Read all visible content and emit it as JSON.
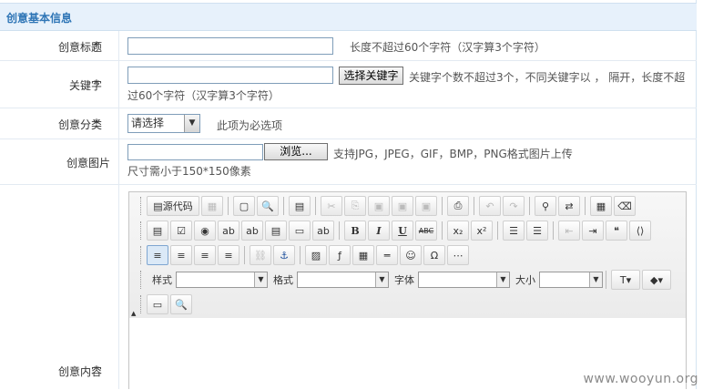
{
  "section_title": "创意基本信息",
  "fields": {
    "title": {
      "label": "创意标题",
      "hint": "长度不超过60个字符（汉字算3个字符）",
      "value": ""
    },
    "keyword": {
      "label": "关键字",
      "button": "选择关键字",
      "hint_line1": "关键字个数不超过3个，不同关键字以 ， 隔开，长度不超",
      "hint_line2": "过60个字符（汉字算3个字符）",
      "value": ""
    },
    "category": {
      "label": "创意分类",
      "selected": "请选择",
      "hint": "此项为必选项"
    },
    "image": {
      "label": "创意图片",
      "browse": "浏览...",
      "hint": "支持JPG，JPEG，GIF，BMP，PNG格式图片上传",
      "size_hint": "尺寸需小于150*150像素"
    },
    "content": {
      "label": "创意内容"
    }
  },
  "editor": {
    "source_label": "源代码",
    "style_label": "样式",
    "format_label": "格式",
    "font_label": "字体",
    "size_label": "大小",
    "bold": "B",
    "italic": "I",
    "underline": "U",
    "strike": "ABC"
  },
  "watermark": "www.wooyun.org",
  "colors": {
    "accent": "#2e75b6",
    "required": "#e10000",
    "header_bg": "#e7f1fb"
  }
}
